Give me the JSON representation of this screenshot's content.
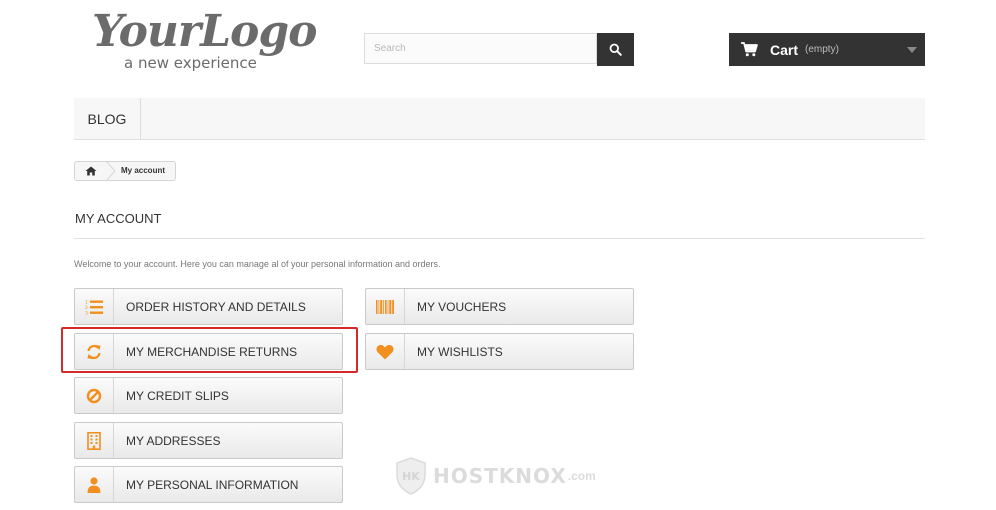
{
  "header": {
    "logo_main": "YourLogo",
    "logo_sub": "a new experience",
    "search_placeholder": "Search",
    "cart_label": "Cart",
    "cart_status": "(empty)"
  },
  "nav": {
    "items": [
      {
        "label": "BLOG"
      }
    ]
  },
  "breadcrumb": {
    "current": "My account"
  },
  "page": {
    "title": "MY ACCOUNT",
    "intro": "Welcome to your account. Here you can manage al of your personal information and orders."
  },
  "account_links": {
    "left": [
      {
        "label": "ORDER HISTORY AND DETAILS",
        "icon": "list-ol-icon"
      },
      {
        "label": "MY MERCHANDISE RETURNS",
        "icon": "refresh-icon"
      },
      {
        "label": "MY CREDIT SLIPS",
        "icon": "ban-icon"
      },
      {
        "label": "MY ADDRESSES",
        "icon": "building-icon"
      },
      {
        "label": "MY PERSONAL INFORMATION",
        "icon": "user-icon"
      }
    ],
    "right": [
      {
        "label": "MY VOUCHERS",
        "icon": "barcode-icon"
      },
      {
        "label": "MY WISHLISTS",
        "icon": "heart-icon"
      }
    ]
  },
  "watermark": {
    "text": "HOSTKNOX",
    "suffix": ".com"
  },
  "colors": {
    "icon_accent": "#f18f1f",
    "dark_bar": "#333333",
    "highlight_border": "#d52a2a"
  }
}
